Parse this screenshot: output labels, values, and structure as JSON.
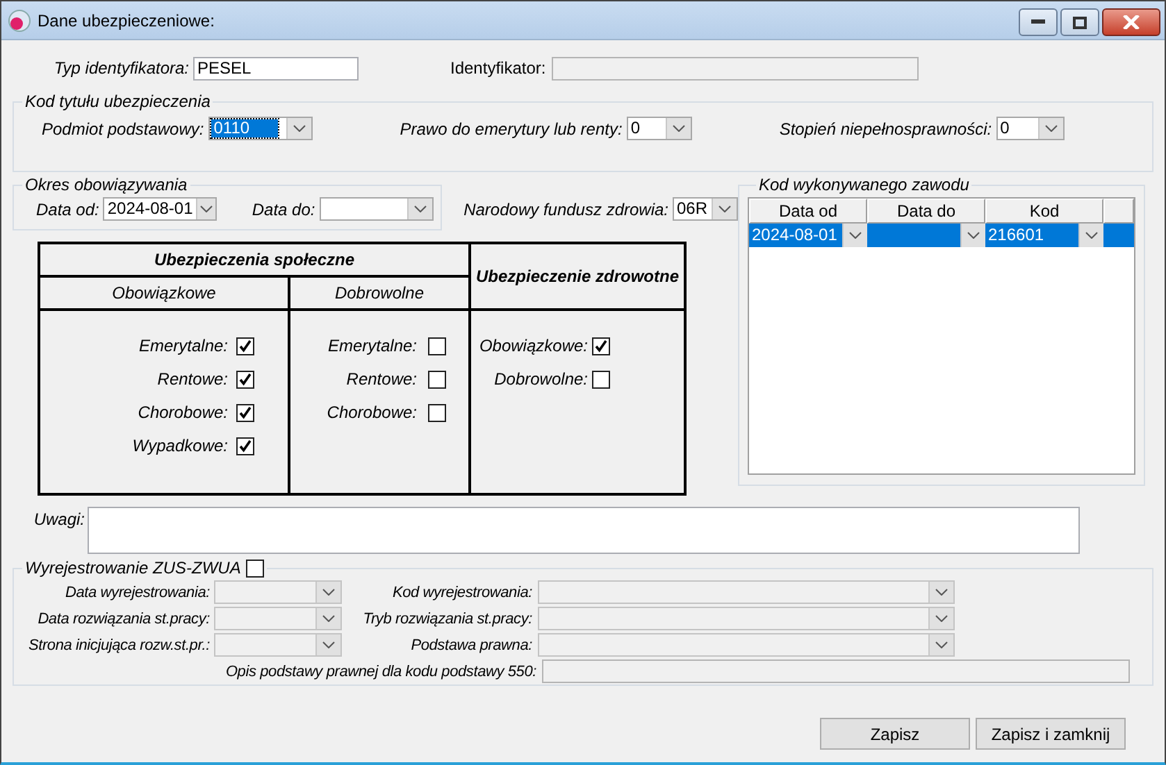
{
  "window": {
    "title": "Dane ubezpieczeniowe:"
  },
  "identification": {
    "type_label": "Typ identyfikatora:",
    "type_value": "PESEL",
    "id_label": "Identyfikator:"
  },
  "insurance_title_code": {
    "legend": "Kod tytułu ubezpieczenia",
    "fields": [
      {
        "label": "Podmiot podstawowy:",
        "value": "0110",
        "selected": true
      },
      {
        "label": "Prawo do emerytury lub renty:",
        "value": "0",
        "selected": false
      },
      {
        "label": "Stopień niepełnosprawności:",
        "value": "0",
        "selected": false
      }
    ]
  },
  "validity": {
    "legend": "Okres obowiązywania",
    "fields": [
      {
        "label": "Data od:",
        "value": "2024-08-01"
      },
      {
        "label": "Data do:"
      }
    ]
  },
  "nfz": {
    "label": "Narodowy fundusz zdrowia:",
    "value": "06R"
  },
  "insurance_table": {
    "social_title": "Ubezpieczenia społeczne",
    "health_title": "Ubezpieczenie zdrowotne",
    "groups": [
      {
        "title": "Obowiązkowe",
        "items": [
          {
            "label": "Emerytalne:",
            "checked": true
          },
          {
            "label": "Rentowe:",
            "checked": true
          },
          {
            "label": "Chorobowe:",
            "checked": true
          },
          {
            "label": "Wypadkowe:",
            "checked": true
          }
        ]
      },
      {
        "title": "Dobrowolne",
        "items": [
          {
            "label": "Emerytalne:",
            "checked": false
          },
          {
            "label": "Rentowe:",
            "checked": false
          },
          {
            "label": "Chorobowe:",
            "checked": false
          }
        ]
      }
    ],
    "health_items": [
      {
        "label": "Obowiązkowe:",
        "checked": true
      },
      {
        "label": "Dobrowolne:",
        "checked": false
      }
    ]
  },
  "occupation": {
    "legend": "Kod wykonywanego zawodu",
    "columns": [
      "Data od",
      "Data do",
      "Kod"
    ],
    "rows": [
      {
        "cells": [
          "2024-08-01",
          null,
          "216601"
        ],
        "selected": true
      }
    ]
  },
  "notes": {
    "label": "Uwagi:"
  },
  "deregistration": {
    "legend": "Wyrejestrowanie ZUS-ZWUA",
    "checked": false,
    "disabled": true,
    "left_fields": [
      "Data wyrejestrowania:",
      "Data rozwiązania st.pracy:",
      "Strona inicjująca rozw.st.pr.:"
    ],
    "right_fields": [
      "Kod wyrejestrowania:",
      "Tryb rozwiązania st.pracy:",
      "Podstawa prawna:"
    ],
    "description_label": "Opis podstawy prawnej dla kodu podstawy 550:"
  },
  "buttons": [
    "Zapisz",
    "Zapisz i zamknij"
  ]
}
